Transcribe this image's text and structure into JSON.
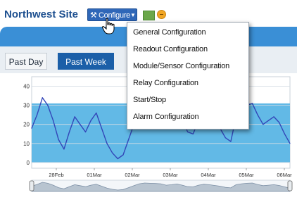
{
  "header": {
    "site_title": "Northwest Site",
    "configure_label": "Configure",
    "wrench_icon": "wrench-icon",
    "caret_icon": "caret-down-icon",
    "status_icon_colors": {
      "green": "#6ba74a",
      "orange": "#f2a623"
    }
  },
  "tabs": [
    {
      "label": "Past Day",
      "active": false
    },
    {
      "label": "Past Week",
      "active": true
    }
  ],
  "menu": {
    "items": [
      "General Configuration",
      "Readout Configuration",
      "Module/Sensor Configuration",
      "Relay Configuration",
      "Start/Stop",
      "Alarm Configuration"
    ]
  },
  "chart_data": {
    "type": "line",
    "x_tick_labels": [
      "28Feb",
      "01Mar",
      "02Mar",
      "03Mar",
      "04Mar",
      "05Mar",
      "06Mar"
    ],
    "y_tick_labels": [
      "40",
      "30",
      "20",
      "10",
      "0"
    ],
    "ylim": [
      -3,
      45
    ],
    "band": {
      "from": 0,
      "to": 31,
      "color": "#62b9e6"
    },
    "line_color": "#3346b8",
    "series": [
      {
        "x": [
          0,
          0.25,
          0.5,
          0.75,
          1.0,
          1.25,
          1.5,
          1.75,
          2.0,
          2.25,
          2.5,
          2.75,
          3.0,
          3.25,
          3.5,
          3.75,
          4.0,
          4.25,
          4.5,
          4.75,
          5.0,
          5.25,
          5.5,
          5.75,
          6.0,
          6.25,
          6.5,
          6.75,
          7.0,
          7.25,
          7.5,
          7.75,
          8.0,
          8.25,
          8.5,
          8.75,
          9.0,
          9.25,
          9.5,
          9.75,
          10.0,
          10.25,
          10.5,
          10.75,
          11.0,
          11.25,
          11.5,
          11.75,
          12.0
        ],
        "y": [
          18,
          25,
          34,
          30,
          22,
          12,
          7,
          16,
          24,
          20,
          16,
          22,
          26,
          18,
          10,
          5,
          2,
          4,
          12,
          20,
          28,
          31,
          30,
          29,
          28,
          22,
          24,
          27,
          22,
          16,
          15,
          22,
          26,
          24,
          21,
          18,
          13,
          11,
          24,
          28,
          30,
          31,
          25,
          20,
          22,
          24,
          21,
          15,
          10
        ]
      }
    ]
  },
  "navigator": {
    "left_handle_icon": "drag-handle-icon",
    "right_handle_icon": "drag-handle-icon"
  }
}
